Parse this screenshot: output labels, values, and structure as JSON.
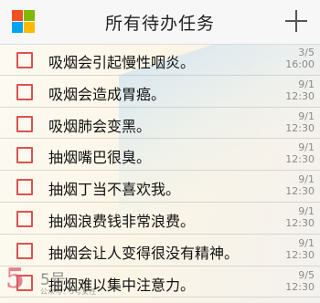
{
  "header": {
    "title": "所有待办任务",
    "add_icon": "plus-icon",
    "app_icon": "windows-logo-icon",
    "logo_colors": [
      "#f25022",
      "#7fba00",
      "#00a4ef",
      "#ffb900"
    ]
  },
  "tasks": [
    {
      "text": "吸烟会引起慢性咽炎。",
      "date": "3/5",
      "time": "16:00"
    },
    {
      "text": "吸烟会造成胃癌。",
      "date": "9/1",
      "time": "12:30"
    },
    {
      "text": "吸烟肺会变黑。",
      "date": "9/1",
      "time": "12:30"
    },
    {
      "text": "抽烟嘴巴很臭。",
      "date": "9/1",
      "time": "12:30"
    },
    {
      "text": "抽烟丁当不喜欢我。",
      "date": "9/1",
      "time": "12:30"
    },
    {
      "text": "抽烟浪费钱非常浪费。",
      "date": "9/1",
      "time": "12:30"
    },
    {
      "text": "抽烟会让人变得很没有精神。",
      "date": "9/1",
      "time": "12:30"
    },
    {
      "text": "抽烟难以集中注意力。",
      "date": "9/5",
      "time": "12:30"
    }
  ],
  "colors": {
    "checkbox_border": "#d9534f"
  },
  "watermark": {
    "mark": "5",
    "name": "5号",
    "subtitle": "公众号：5号女性"
  }
}
